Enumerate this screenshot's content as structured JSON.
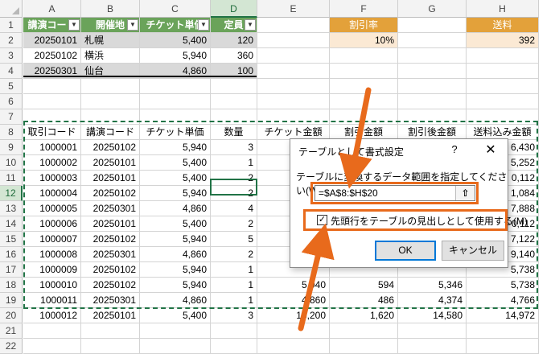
{
  "columns": [
    "A",
    "B",
    "C",
    "D",
    "E",
    "F",
    "G",
    "H"
  ],
  "rows": [
    "1",
    "2",
    "3",
    "4",
    "5",
    "6",
    "7",
    "8",
    "9",
    "10",
    "11",
    "12",
    "13",
    "14",
    "15",
    "16",
    "17",
    "18",
    "19",
    "20",
    "21",
    "22"
  ],
  "top_table": {
    "headers": [
      "講演コード",
      "開催地",
      "チケット単価",
      "定員"
    ],
    "rows": [
      [
        "20250101",
        "札幌",
        "5,400",
        "120"
      ],
      [
        "20250102",
        "横浜",
        "5,940",
        "360"
      ],
      [
        "20250301",
        "仙台",
        "4,860",
        "100"
      ]
    ]
  },
  "discount": {
    "label": "割引率",
    "value": "10%"
  },
  "shipping": {
    "label": "送料",
    "value": "392"
  },
  "main_table": {
    "headers": [
      "取引コード",
      "講演コード",
      "チケット単価",
      "数量",
      "チケット金額",
      "割引金額",
      "割引後金額",
      "送料込み金額"
    ],
    "rows": [
      [
        "1000001",
        "20250102",
        "5,940",
        "3",
        "",
        "",
        "",
        "6,430"
      ],
      [
        "1000002",
        "20250101",
        "5,400",
        "1",
        "",
        "",
        "",
        "5,252"
      ],
      [
        "1000003",
        "20250101",
        "5,400",
        "2",
        "",
        "",
        "",
        "0,112"
      ],
      [
        "1000004",
        "20250102",
        "5,940",
        "2",
        "",
        "",
        "",
        "1,084"
      ],
      [
        "1000005",
        "20250301",
        "4,860",
        "4",
        "",
        "",
        "",
        "7,888"
      ],
      [
        "1000006",
        "20250101",
        "5,400",
        "2",
        "",
        "",
        "",
        "0,112"
      ],
      [
        "1000007",
        "20250102",
        "5,940",
        "5",
        "",
        "",
        "",
        "7,122"
      ],
      [
        "1000008",
        "20250301",
        "4,860",
        "2",
        "",
        "",
        "",
        "9,140"
      ],
      [
        "1000009",
        "20250102",
        "5,940",
        "1",
        "",
        "",
        "",
        "5,738"
      ],
      [
        "1000010",
        "20250102",
        "5,940",
        "1",
        "5,940",
        "594",
        "5,346",
        "5,738"
      ],
      [
        "1000011",
        "20250301",
        "4,860",
        "1",
        "4,860",
        "486",
        "4,374",
        "4,766"
      ],
      [
        "1000012",
        "20250101",
        "5,400",
        "3",
        "16,200",
        "1,620",
        "14,580",
        "14,972"
      ]
    ]
  },
  "dialog": {
    "title": "テーブルとして書式設定",
    "help": "?",
    "close": "✕",
    "prompt": "テーブルに変換するデータ範囲を指定してください(W)",
    "range_value": "=$A$8:$H$20",
    "collapse_icon": "⇧",
    "checkbox_mark": "✓",
    "checkbox_label": "先頭行をテーブルの見出しとして使用する(M)",
    "ok": "OK",
    "cancel": "キャンセル"
  },
  "colors": {
    "accent_orange": "#e86a1c",
    "excel_green": "#217346",
    "table_header_green": "#6aa35a"
  }
}
